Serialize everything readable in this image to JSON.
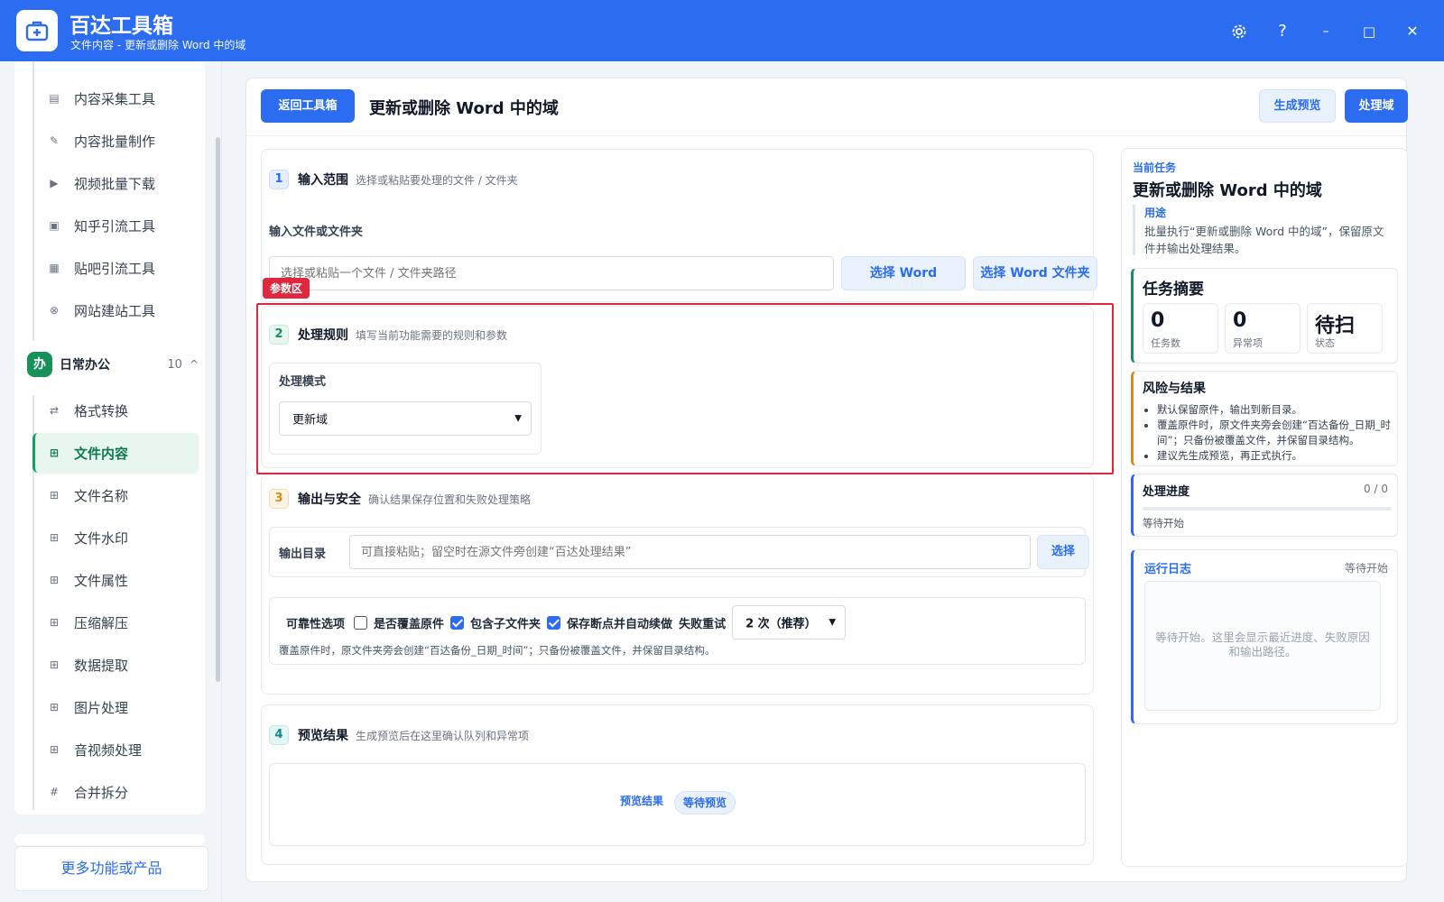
{
  "app": {
    "title": "百达工具箱",
    "subtitle": "文件内容 - 更新或删除 Word 中的域"
  },
  "titlebar": {
    "settings_icon": "gear-icon",
    "help_label": "?",
    "minimize_label": "–",
    "maximize_label": "□",
    "close_label": "✕"
  },
  "sidebar": {
    "top_items": [
      {
        "label": "内容采集工具",
        "icon": "document-icon"
      },
      {
        "label": "内容批量制作",
        "icon": "pen-icon"
      },
      {
        "label": "视频批量下载",
        "icon": "video-icon"
      },
      {
        "label": "知乎引流工具",
        "icon": "zhihu-icon"
      },
      {
        "label": "贴吧引流工具",
        "icon": "message-icon"
      },
      {
        "label": "网站建站工具",
        "icon": "globe-icon"
      }
    ],
    "group": {
      "badge": "办",
      "title": "日常办公",
      "count": "10",
      "caret": "^"
    },
    "group_items": [
      {
        "label": "格式转换",
        "icon": "swap-icon"
      },
      {
        "label": "文件内容",
        "icon": "grid-icon",
        "active": true
      },
      {
        "label": "文件名称",
        "icon": "grid-icon"
      },
      {
        "label": "文件水印",
        "icon": "grid-icon"
      },
      {
        "label": "文件属性",
        "icon": "grid-icon"
      },
      {
        "label": "压缩解压",
        "icon": "grid-icon"
      },
      {
        "label": "数据提取",
        "icon": "grid-icon"
      },
      {
        "label": "图片处理",
        "icon": "grid-icon"
      },
      {
        "label": "音视频处理",
        "icon": "grid-icon"
      },
      {
        "label": "合并拆分",
        "icon": "hash-icon"
      }
    ],
    "more_label": "更多功能或产品"
  },
  "main": {
    "back_label": "返回工具箱",
    "page_title": "更新或删除 Word 中的域",
    "preview_label": "生成预览",
    "process_label": "处理域",
    "section1": {
      "num": "1",
      "title": "输入范围",
      "desc": "选择或粘贴要处理的文件 / 文件夹",
      "field_label": "输入文件或文件夹",
      "input_placeholder": "选择或粘贴一个文件 / 文件夹路径",
      "select_word_label": "选择 Word",
      "select_folder_label": "选择 Word 文件夹"
    },
    "param_tag": "参数区",
    "section2": {
      "num": "2",
      "title": "处理规则",
      "desc": "填写当前功能需要的规则和参数",
      "mode_label": "处理模式",
      "mode_value": "更新域"
    },
    "section3": {
      "num": "3",
      "title": "输出与安全",
      "desc": "确认结果保存位置和失败处理策略",
      "output_label": "输出目录",
      "output_placeholder": "可直接粘贴；留空时在源文件旁创建“百达处理结果”",
      "choose_label": "选择",
      "reliability_label": "可靠性选项",
      "overwrite_label": "是否覆盖原件",
      "overwrite_checked": false,
      "subfolder_label": "包含子文件夹",
      "subfolder_checked": true,
      "resume_label": "保存断点并自动续做",
      "resume_checked": true,
      "retry_label": "失败重试",
      "retry_value": "2 次（推荐）",
      "note": "覆盖原件时，原文件夹旁会创建“百达备份_日期_时间”；只备份被覆盖文件，并保留目录结构。"
    },
    "section4": {
      "num": "4",
      "title": "预览结果",
      "desc": "生成预览后在这里确认队列和异常项",
      "result_label": "预览结果",
      "status_badge": "等待预览"
    }
  },
  "right": {
    "current_label": "当前任务",
    "task_title": "更新或删除 Word 中的域",
    "purpose_label": "用途",
    "purpose_text": "批量执行“更新或删除 Word 中的域”，保留原文件并输出处理结果。",
    "summary_title": "任务摘要",
    "stats": [
      {
        "value": "0",
        "key": "任务数"
      },
      {
        "value": "0",
        "key": "异常项"
      },
      {
        "value": "待扫",
        "key": "状态"
      }
    ],
    "risk_title": "风险与结果",
    "risk_items": [
      "默认保留原件，输出到新目录。",
      "覆盖原件时，原文件夹旁会创建“百达备份_日期_时间”；只备份被覆盖文件，并保留目录结构。",
      "建议先生成预览，再正式执行。"
    ],
    "progress_title": "处理进度",
    "progress_count": "0 / 0",
    "progress_fraction": 0,
    "progress_status": "等待开始",
    "log_title": "运行日志",
    "log_status": "等待开始",
    "log_text": "等待开始。这里会显示最近进度、失败原因和输出路径。"
  },
  "colors": {
    "brand": "#2b6cf0",
    "active_green": "#16915a",
    "highlight_red": "#e0273e",
    "warning_orange": "#d98a1d"
  }
}
